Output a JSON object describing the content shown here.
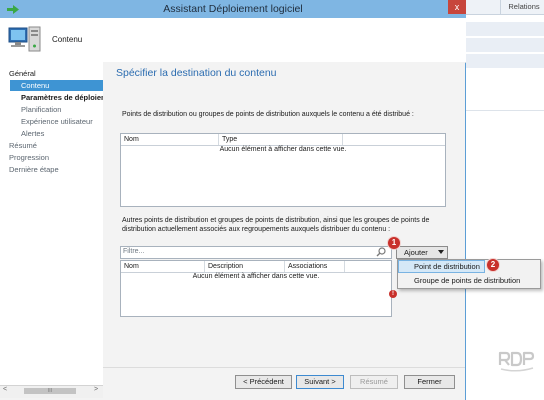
{
  "background_app": {
    "column_header": "Relations"
  },
  "window": {
    "title": "Assistant Déploiement logiciel",
    "close_glyph": "x"
  },
  "header": {
    "page_name": "Contenu"
  },
  "nav": {
    "items": [
      {
        "label": "Général",
        "level": 1,
        "state": "normal"
      },
      {
        "label": "Contenu",
        "level": 2,
        "state": "selected"
      },
      {
        "label": "Paramètres de déploieme",
        "level": 2,
        "state": "bold"
      },
      {
        "label": "Planification",
        "level": 2,
        "state": "dim"
      },
      {
        "label": "Expérience utilisateur",
        "level": 2,
        "state": "dim"
      },
      {
        "label": "Alertes",
        "level": 2,
        "state": "dim"
      },
      {
        "label": "Résumé",
        "level": 1,
        "state": "dim"
      },
      {
        "label": "Progression",
        "level": 1,
        "state": "dim"
      },
      {
        "label": "Dernière étape",
        "level": 1,
        "state": "dim"
      }
    ],
    "scroll_left": "<",
    "scroll_thumb": "III",
    "scroll_right": ">"
  },
  "main": {
    "section_title": "Spécifier la destination du contenu",
    "desc1": "Points de distribution ou groupes de points de distribution auxquels le contenu a été distribué :",
    "grid1": {
      "columns": [
        "Nom",
        "Type"
      ],
      "empty_message": "Aucun élément à afficher dans cette vue."
    },
    "desc2": "Autres points de distribution et groupes de points de distribution, ainsi que les groupes de points de distribution actuellement associés aux regroupements auxquels distribuer du contenu :",
    "filter_placeholder": "Filtre...",
    "grid2": {
      "columns": [
        "Nom",
        "Description",
        "Associations"
      ],
      "empty_message": "Aucun élément à afficher dans cette vue."
    },
    "add_button": "Ajouter"
  },
  "menu": {
    "items": [
      "Point de distribution",
      "Groupe de points de distribution"
    ]
  },
  "callouts": [
    "1",
    "2"
  ],
  "error_glyph": "!",
  "buttons": {
    "previous": "< Précédent",
    "next": "Suivant >",
    "summary": "Résumé",
    "close": "Fermer"
  },
  "colors": {
    "accent": "#3e94d3",
    "title_bar": "#7fb6e3",
    "section_title": "#2b6cb0",
    "callout": "#c8302b",
    "close_button": "#c7463c"
  }
}
